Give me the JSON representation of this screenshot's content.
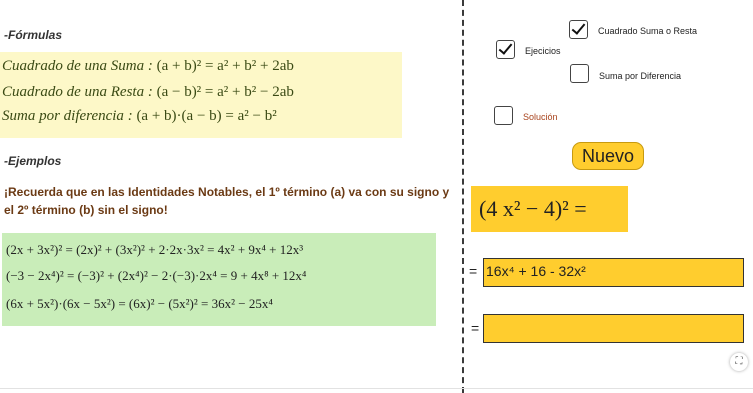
{
  "left_panel": {
    "formulas_heading": "-Fórmulas",
    "formulas": [
      {
        "name": "Cuadrado de una Suma",
        "expr": "(a + b)² = a² + b² + 2ab"
      },
      {
        "name": "Cuadrado de una Resta",
        "expr": "(a − b)² = a² + b² − 2ab"
      },
      {
        "name": "Suma por diferencia",
        "expr": "(a + b)·(a − b) = a² − b²"
      }
    ],
    "examples_heading": "-Ejemplos",
    "note_line1": "¡Recuerda que en las Identidades Notables, el 1º término (a) va con su signo y",
    "note_line2": "el 2º término (b) sin el signo!",
    "examples": [
      "(2x + 3x²)² = (2x)² + (3x²)² + 2·2x·3x² = 4x² + 9x⁴ + 12x³",
      "(−3 − 2x⁴)² = (−3)² + (2x⁴)² − 2·(−3)·2x⁴ = 9 + 4x⁸ + 12x⁴",
      "(6x + 5x²)·(6x − 5x²) = (6x)² − (5x²)² = 36x² − 25x⁴"
    ]
  },
  "controls": {
    "cuadrado_label": "Cuadrado Suma o Resta",
    "cuadrado_checked": true,
    "ejercicios_label": "Ejecicios",
    "ejercicios_checked": true,
    "suma_label": "Suma por Diferencia",
    "suma_checked": false,
    "solucion_label": "Solución",
    "solucion_checked": false,
    "nuevo_label": "Nuevo"
  },
  "exercise": {
    "expression": "(4 x² − 4)² =",
    "answer1_prefix": "=",
    "answer1_value": "16x⁴ + 16 - 32x²",
    "answer2_prefix": "=",
    "answer2_value": ""
  },
  "colors": {
    "formula_bg": "#fdf8c8",
    "examples_bg": "#c9edb9",
    "accent_yellow": "#ffcd2e",
    "note_text": "#6b3a14",
    "solucion_text": "#a8431c"
  },
  "icons": {
    "fullscreen": "fullscreen-icon"
  }
}
